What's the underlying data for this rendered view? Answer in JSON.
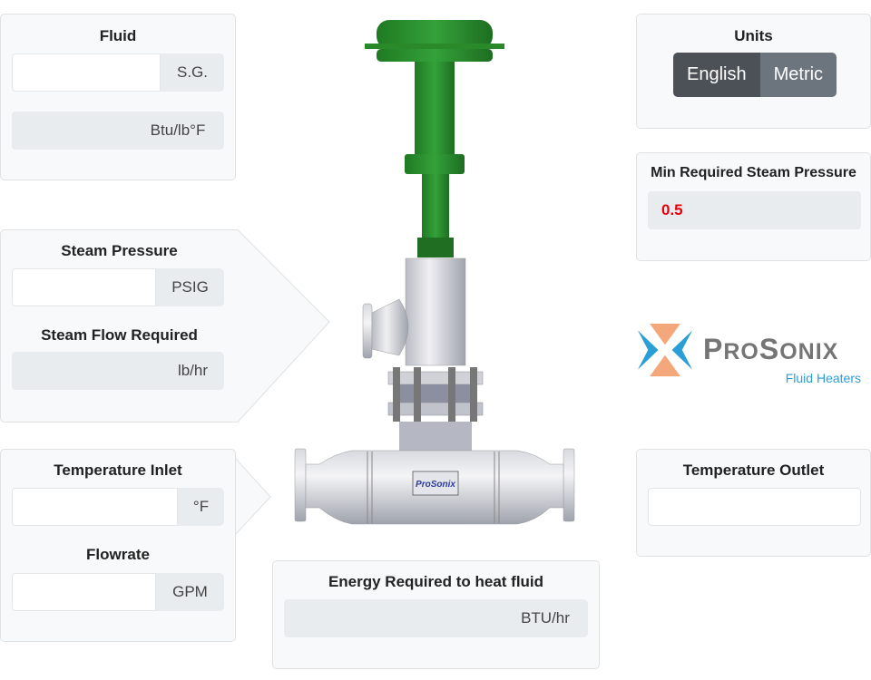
{
  "fluid": {
    "title": "Fluid",
    "sg_value": "",
    "sg_unit": "S.G.",
    "cp_value": "",
    "cp_unit": "Btu/lb°F"
  },
  "steam": {
    "pressure_label": "Steam Pressure",
    "pressure_value": "",
    "pressure_unit": "PSIG",
    "flow_label": "Steam Flow Required",
    "flow_value": "",
    "flow_unit": "lb/hr"
  },
  "temp_in": {
    "label": "Temperature Inlet",
    "value": "",
    "unit": "°F",
    "flow_label": "Flowrate",
    "flow_value": "",
    "flow_unit": "GPM"
  },
  "energy": {
    "label": "Energy Required to heat fluid",
    "value": "",
    "unit": "BTU/hr"
  },
  "units": {
    "title": "Units",
    "options": [
      "English",
      "Metric"
    ],
    "selected": "English"
  },
  "min_steam": {
    "label": "Min Required Steam Pressure",
    "value": "0.5",
    "value_color": "#e8000b"
  },
  "temp_out": {
    "label": "Temperature Outlet",
    "value": ""
  },
  "logo": {
    "name": "ProSonix",
    "tagline": "Fluid Heaters",
    "brand_blue": "#2a9fd6",
    "brand_orange": "#f08a4b"
  },
  "valve_image": {
    "nameplate": "ProSonix",
    "actuator_color": "#2a8a2a"
  }
}
